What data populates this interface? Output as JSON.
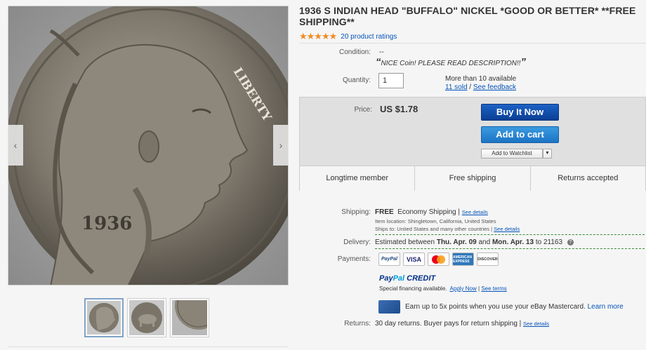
{
  "listing": {
    "title": "1936 S INDIAN HEAD \"BUFFALO\" NICKEL *GOOD OR BETTER* **FREE SHIPPING**",
    "stars": "★★★★★",
    "rating_count": "20 product ratings"
  },
  "gallery": {
    "prev_glyph": "‹",
    "next_glyph": "›",
    "coin_lettering": "LIBERTY",
    "coin_date": "1936"
  },
  "condition": {
    "label": "Condition:",
    "value": "--",
    "description": "NICE Coin! PLEASE READ DESCRIPTION!!"
  },
  "quantity": {
    "label": "Quantity:",
    "value": "1",
    "available": "More than 10 available",
    "sold": "11 sold",
    "separator": "/",
    "feedback": "See feedback"
  },
  "buybox": {
    "price_label": "Price:",
    "price": "US $1.78",
    "buy_now": "Buy It Now",
    "add_to_cart": "Add to cart",
    "watchlist": "Add to Watchlist",
    "watchlist_arrow": "▼"
  },
  "badges": [
    "Longtime member",
    "Free shipping",
    "Returns accepted"
  ],
  "shipping": {
    "label": "Shipping:",
    "free": "FREE",
    "method": "Economy Shipping |",
    "details_link": "See details",
    "item_location": "Item location:  Shingletown, California, United States",
    "ships_to": "Ships to:  United States and many other countries |",
    "ships_to_link": "See details"
  },
  "delivery": {
    "label": "Delivery:",
    "prefix": "Estimated between",
    "date1": "Thu. Apr. 09",
    "and": "and",
    "date2": "Mon. Apr. 13",
    "suffix": "to 21163",
    "help": "?"
  },
  "payments": {
    "label": "Payments:",
    "paypal": "PayPal",
    "visa": "VISA",
    "amex": "AMERICAN EXPRESS",
    "discover": "DISCOVER",
    "mc_red": "#eb001b",
    "mc_yellow": "#f79e1b",
    "credit_pay": "Pay",
    "credit_pal": "Pal",
    "credit_word": "CREDIT",
    "financing": "Special financing available.",
    "apply_now": "Apply Now",
    "sep": "|",
    "see_terms": "See terms",
    "mastercard_text": "Earn up to 5x points when you use your eBay Mastercard.",
    "learn_more": "Learn more"
  },
  "returns": {
    "label": "Returns:",
    "value": "30 day returns. Buyer pays for return shipping |",
    "link": "See details"
  }
}
